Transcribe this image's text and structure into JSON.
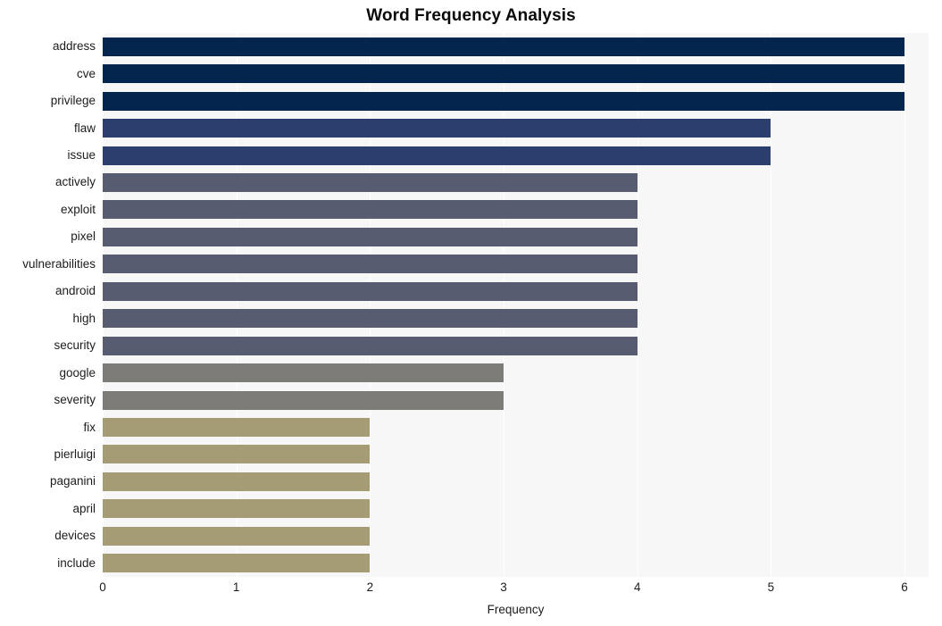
{
  "chart_data": {
    "type": "bar",
    "orientation": "horizontal",
    "title": "Word Frequency Analysis",
    "xlabel": "Frequency",
    "ylabel": "",
    "xlim": [
      0,
      6.18
    ],
    "xticks": [
      0,
      1,
      2,
      3,
      4,
      5,
      6
    ],
    "xtick_labels": [
      "0",
      "1",
      "2",
      "3",
      "4",
      "5",
      "6"
    ],
    "grid": true,
    "grid_axis": "x",
    "legend": false,
    "plot_background": "#f7f7f8",
    "figure_background": "#ffffff",
    "categories": [
      "address",
      "cve",
      "privilege",
      "flaw",
      "issue",
      "actively",
      "exploit",
      "pixel",
      "vulnerabilities",
      "android",
      "high",
      "security",
      "google",
      "severity",
      "fix",
      "pierluigi",
      "paganini",
      "april",
      "devices",
      "include"
    ],
    "values": [
      6,
      6,
      6,
      5,
      5,
      4,
      4,
      4,
      4,
      4,
      4,
      4,
      3,
      3,
      2,
      2,
      2,
      2,
      2,
      2
    ],
    "bar_colors": [
      "#04254e",
      "#04254e",
      "#04254e",
      "#2c3e6e",
      "#2c3e6e",
      "#575c70",
      "#575c70",
      "#575c70",
      "#575c70",
      "#575c70",
      "#575c70",
      "#575c70",
      "#7c7b78",
      "#7c7b78",
      "#a59b75",
      "#a59b75",
      "#a59b75",
      "#a59b75",
      "#a59b75",
      "#a59b75"
    ]
  }
}
